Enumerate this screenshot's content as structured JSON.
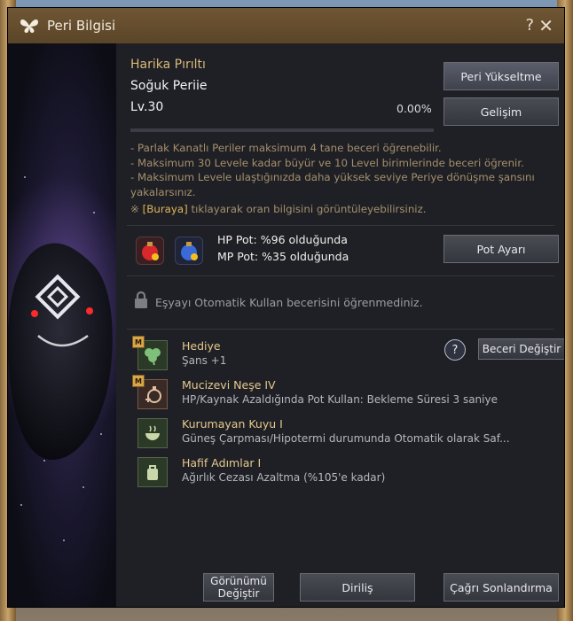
{
  "window": {
    "title": "Peri Bilgisi",
    "help_label": "?",
    "close_label": "✕"
  },
  "fairy": {
    "grade": "Harika Pırıltı",
    "name": "Soğuk Periie",
    "level_prefix": "Lv.",
    "level": "30",
    "progress_text": "0.00%",
    "progress": 0.0
  },
  "buttons": {
    "upgrade": "Peri Yükseltme",
    "evolve": "Gelişim",
    "pot_settings": "Pot Ayarı",
    "change_skill": "Beceri Değiştir",
    "change_look_line1": "Görünümü",
    "change_look_line2": "Değiştir",
    "revive": "Diriliş",
    "end_summon": "Çağrı Sonlandırma"
  },
  "info_lines": [
    "- Parlak Kanatlı Periler maksimum 4 tane beceri öğrenebilir.",
    "- Maksimum 30 Levele kadar büyür ve 10 Level birimlerinde beceri öğrenir.",
    "- Maksimum Levele ulaştığınızda daha yüksek seviye Periye dönüşme şansını",
    "yakalarsınız."
  ],
  "note": {
    "prefix": "※ ",
    "link": "[Buraya]",
    "text": " tıklayarak oran bilgisini görüntüleyebilirsiniz."
  },
  "pots": {
    "hp_label": "HP Pot: ",
    "hp_value": "%96 olduğunda",
    "mp_label": "MP Pot: ",
    "mp_value": "%35 olduğunda"
  },
  "auto_use": {
    "text": "Eşyayı Otomatik Kullan becerisini öğrenmediniz."
  },
  "skills": [
    {
      "badge": "M",
      "name": "Hediye",
      "desc": "Şans +1",
      "icon": "clover-icon"
    },
    {
      "badge": "M",
      "name": "Mucizevi Neşe IV",
      "desc": "HP/Kaynak Azaldığında Pot Kullan: Bekleme Süresi 3 saniye",
      "icon": "potion-plus-icon"
    },
    {
      "badge": "",
      "name": "Kurumayan Kuyu I",
      "desc": "Güneş Çarpması/Hipotermi durumunda Otomatik olarak Saf...",
      "icon": "bowl-icon"
    },
    {
      "badge": "",
      "name": "Hafif Adımlar I",
      "desc": "Ağırlık Cezası Azaltma (%105'e kadar)",
      "icon": "bag-icon"
    }
  ],
  "colors": {
    "title_bar": "#5b4528",
    "accent_gold": "#e0b45a",
    "panel_bg": "#1f2026"
  }
}
